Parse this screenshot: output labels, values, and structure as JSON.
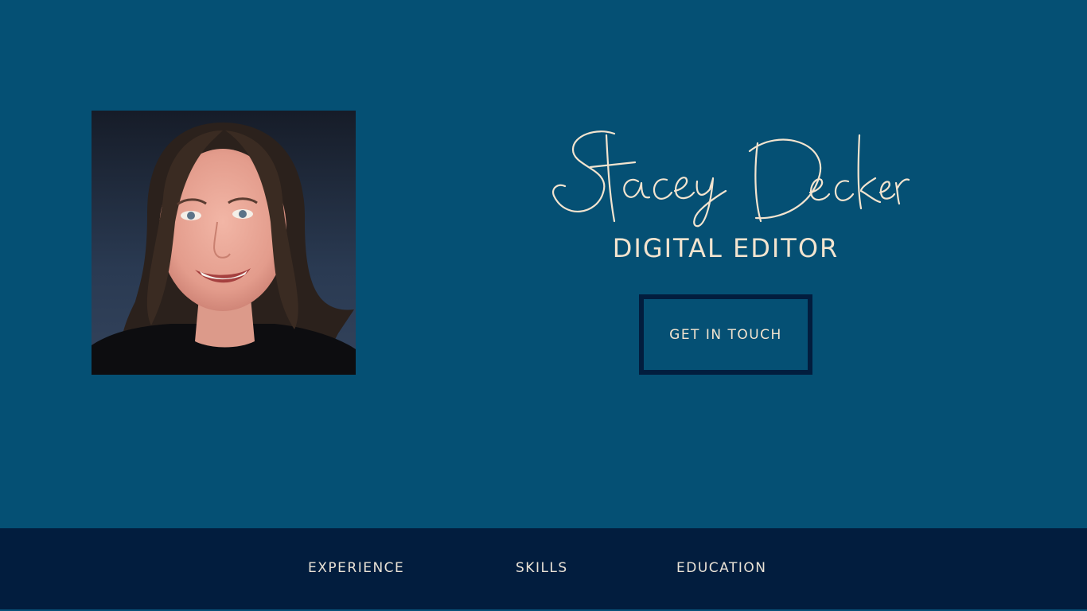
{
  "profile": {
    "name": "Stacey Decker",
    "title": "DIGITAL EDITOR",
    "cta_label": "GET IN TOUCH"
  },
  "nav": {
    "items": [
      {
        "label": "EXPERIENCE"
      },
      {
        "label": "SKILLS"
      },
      {
        "label": "EDUCATION"
      }
    ]
  },
  "colors": {
    "hero_background": "#055074",
    "footer_background": "#021d3e",
    "accent_text": "#f3e4cf",
    "button_border": "#021d3e"
  }
}
